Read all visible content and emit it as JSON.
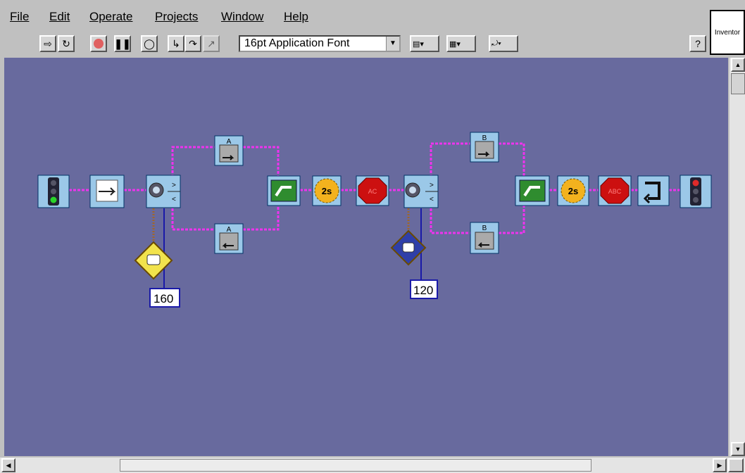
{
  "menu": {
    "file": "File",
    "edit": "Edit",
    "operate": "Operate",
    "projects": "Projects",
    "window": "Window",
    "help": "Help"
  },
  "toolbar": {
    "font_selector": "16pt Application Font",
    "help_button": "?"
  },
  "inventor_tab": "Inventor",
  "program": {
    "blocks": [
      {
        "type": "start-traffic-light",
        "label": ""
      },
      {
        "type": "output-block",
        "label": ""
      },
      {
        "type": "light-sensor-fork",
        "label": ""
      },
      {
        "type": "motor-block",
        "label": "A"
      },
      {
        "type": "motor-block",
        "label": "A"
      },
      {
        "type": "fork-merge",
        "label": ""
      },
      {
        "type": "wait-timer",
        "label": "2s"
      },
      {
        "type": "stop-sign",
        "label": "AC"
      },
      {
        "type": "light-sensor-fork",
        "label": ""
      },
      {
        "type": "motor-block",
        "label": "B"
      },
      {
        "type": "motor-block",
        "label": "B"
      },
      {
        "type": "fork-merge",
        "label": ""
      },
      {
        "type": "wait-timer",
        "label": "2s"
      },
      {
        "type": "stop-sign",
        "label": "ABC"
      },
      {
        "type": "jump-block",
        "label": ""
      },
      {
        "type": "end-traffic-light",
        "label": ""
      }
    ],
    "threshold_1": "160",
    "threshold_2": "120"
  },
  "colors": {
    "canvas": "#686a9e",
    "wire": "#ee33ee",
    "block_bg": "#9bc8e8",
    "merge_green": "#2f8c2f",
    "timer_orange": "#f3b21e",
    "stop_red": "#cc1010",
    "sensor_yellow": "#f2e34c",
    "sensor_blue": "#2f3fa8"
  }
}
